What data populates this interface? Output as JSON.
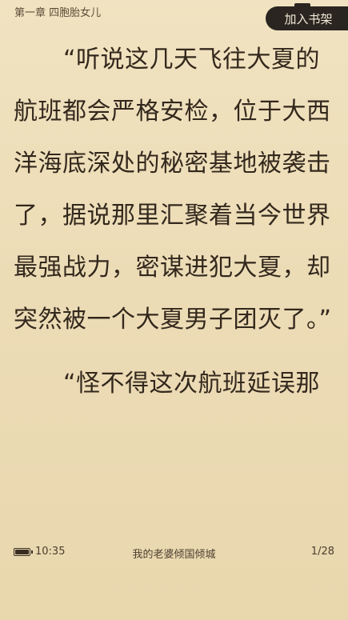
{
  "header": {
    "chapter_title": "第一章 四胞胎女儿",
    "add_to_shelf_label": "加入书架"
  },
  "content": {
    "paragraphs": [
      "“听说这几天飞往大夏的航班都会严格安检，位于大西洋海底深处的秘密基地被袭击了，据说那里汇聚着当今世界最强战力，密谋进犯大夏，却突然被一个大夏男子团灭了。”",
      "“怪不得这次航班延误那"
    ]
  },
  "footer": {
    "battery_level": 1.0,
    "time": "10:35",
    "book_title": "我的老婆倾国倾城",
    "page": "1/28"
  },
  "colors": {
    "background": "#efe0bb",
    "text": "#33281d",
    "button_bg": "#2a2520",
    "button_text": "#f3ead8"
  }
}
